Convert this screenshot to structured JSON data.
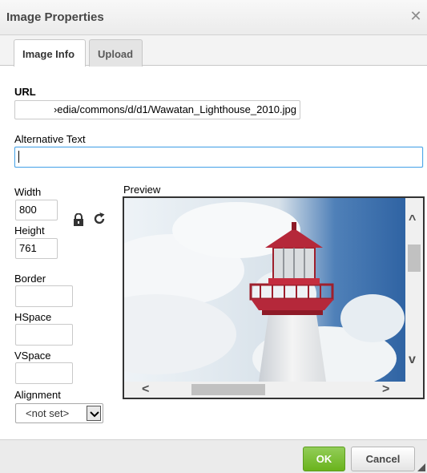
{
  "dialog": {
    "title": "Image Properties",
    "close_glyph": "✕"
  },
  "tabs": [
    {
      "label": "Image Info",
      "active": true
    },
    {
      "label": "Upload",
      "active": false
    }
  ],
  "fields": {
    "url_label": "URL",
    "url_value": "›edia/commons/d/d1/Wawatan_Lighthouse_2010.jpg",
    "alt_label": "Alternative Text",
    "alt_value": "",
    "width_label": "Width",
    "width_value": "800",
    "height_label": "Height",
    "height_value": "761",
    "border_label": "Border",
    "border_value": "",
    "hspace_label": "HSpace",
    "hspace_value": "",
    "vspace_label": "VSpace",
    "vspace_value": "",
    "alignment_label": "Alignment",
    "alignment_value": "<not set>"
  },
  "preview": {
    "label": "Preview",
    "image_subject": "lighthouse"
  },
  "footer": {
    "ok_label": "OK",
    "cancel_label": "Cancel"
  },
  "icons": {
    "lock": "lock-icon",
    "reset": "reset-size-icon",
    "close": "close-icon"
  },
  "colors": {
    "ok_green": "#76b72a",
    "focus_blue": "#51a7e8",
    "lighthouse_red": "#b5283a"
  }
}
